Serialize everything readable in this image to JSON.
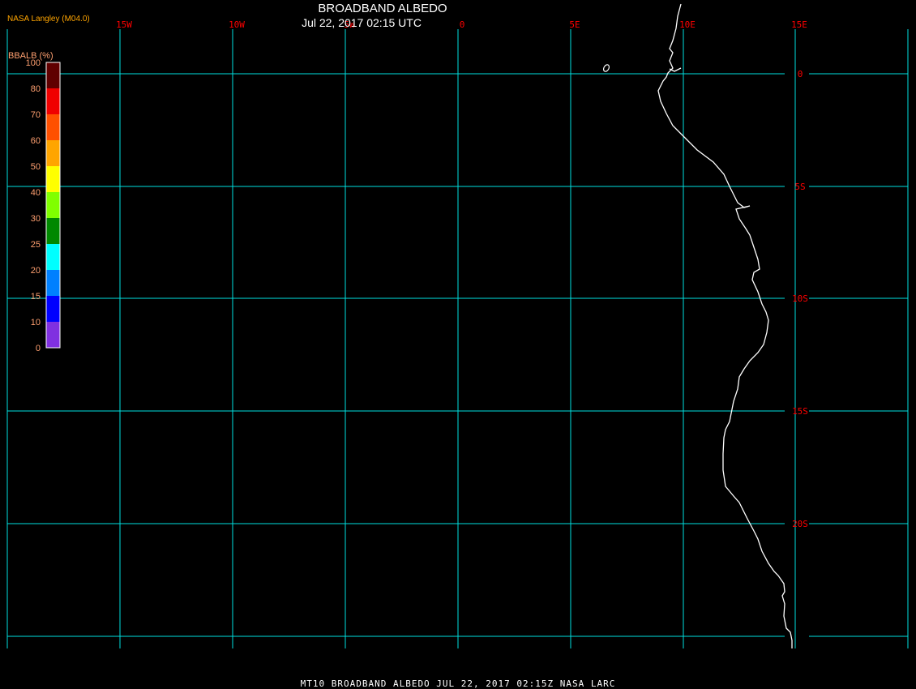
{
  "header": {
    "title": "BROADBAND ALBEDO",
    "datetime": "Jul 22, 2017 02:15 UTC",
    "credit": "NASA Langley (M04.0)"
  },
  "footer": {
    "caption": "MT10  BROADBAND ALBEDO   JUL 22, 2017 02:15Z   NASA LARC"
  },
  "map": {
    "lon_labels": [
      "15W",
      "10W",
      "5W",
      "0",
      "5E",
      "10E",
      "15E"
    ],
    "lat_labels": [
      "0",
      "5S",
      "10S",
      "15S",
      "20S"
    ],
    "grid_color": "#00e0e0",
    "label_color": "#ff0000",
    "coastline_color": "#ffffff"
  },
  "colorbar": {
    "title": "BBALB (%)",
    "labels": [
      "100",
      "80",
      "70",
      "60",
      "50",
      "40",
      "30",
      "25",
      "20",
      "15",
      "10",
      "0"
    ],
    "colors": [
      "#600000",
      "#f00000",
      "#ff5000",
      "#ffa500",
      "#ffff00",
      "#80ff00",
      "#008800",
      "#00ffff",
      "#0080ff",
      "#0000ff",
      "#8030e0"
    ]
  }
}
